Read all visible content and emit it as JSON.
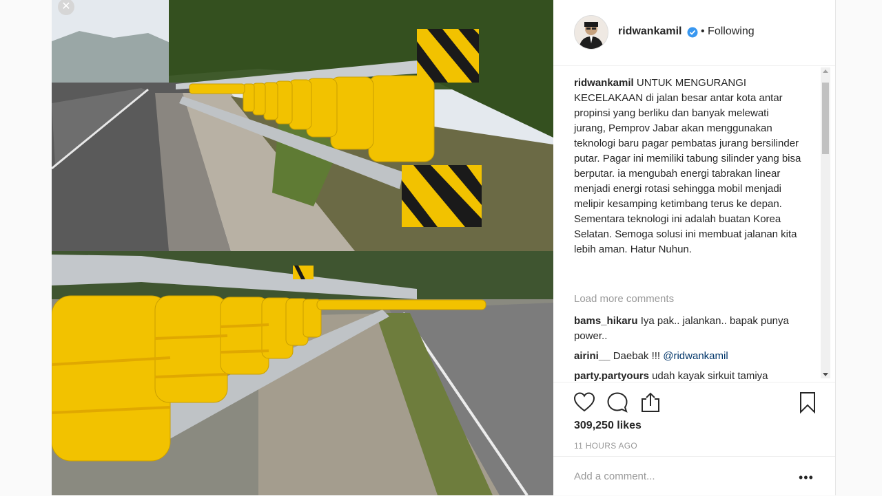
{
  "post": {
    "username": "ridwankamil",
    "following_label": "• Following",
    "caption_text": "UNTUK MENGURANGI KECELAKAAN di jalan besar antar kota antar propinsi yang berliku dan banyak melewati jurang, Pemprov Jabar akan menggunakan teknologi baru pagar pembatas jurang bersilinder putar. Pagar ini memiliki tabung silinder yang bisa berputar. ia mengubah energi tabrakan linear menjadi energi rotasi sehingga mobil menjadi melipir kesamping ketimbang terus ke depan. Sementara teknologi ini adalah buatan Korea Selatan. Semoga solusi ini membuat jalanan kita lebih aman. Hatur Nuhun.",
    "load_more": "Load more comments",
    "comments": [
      {
        "user": "bams_hikaru",
        "text": "Iya pak.. jalankan.. bapak punya power.."
      },
      {
        "user": "airini__",
        "text": "Daebak !!!",
        "mention": "@ridwankamil"
      },
      {
        "user": "party.partyours",
        "text": "udah kayak sirkuit tamiya"
      }
    ],
    "likes": "309,250 likes",
    "time": "11 HOURS AGO",
    "add_comment_placeholder": "Add a comment...",
    "more_label": "•••"
  },
  "icons": {
    "close": "close-icon",
    "verified": "verified-badge-icon",
    "like": "heart-icon",
    "comment": "comment-icon",
    "share": "share-icon",
    "save": "bookmark-icon"
  },
  "colors": {
    "guardrail_yellow": "#f2c200",
    "verified_blue": "#3897f0",
    "text": "#262626",
    "muted": "#999999"
  }
}
